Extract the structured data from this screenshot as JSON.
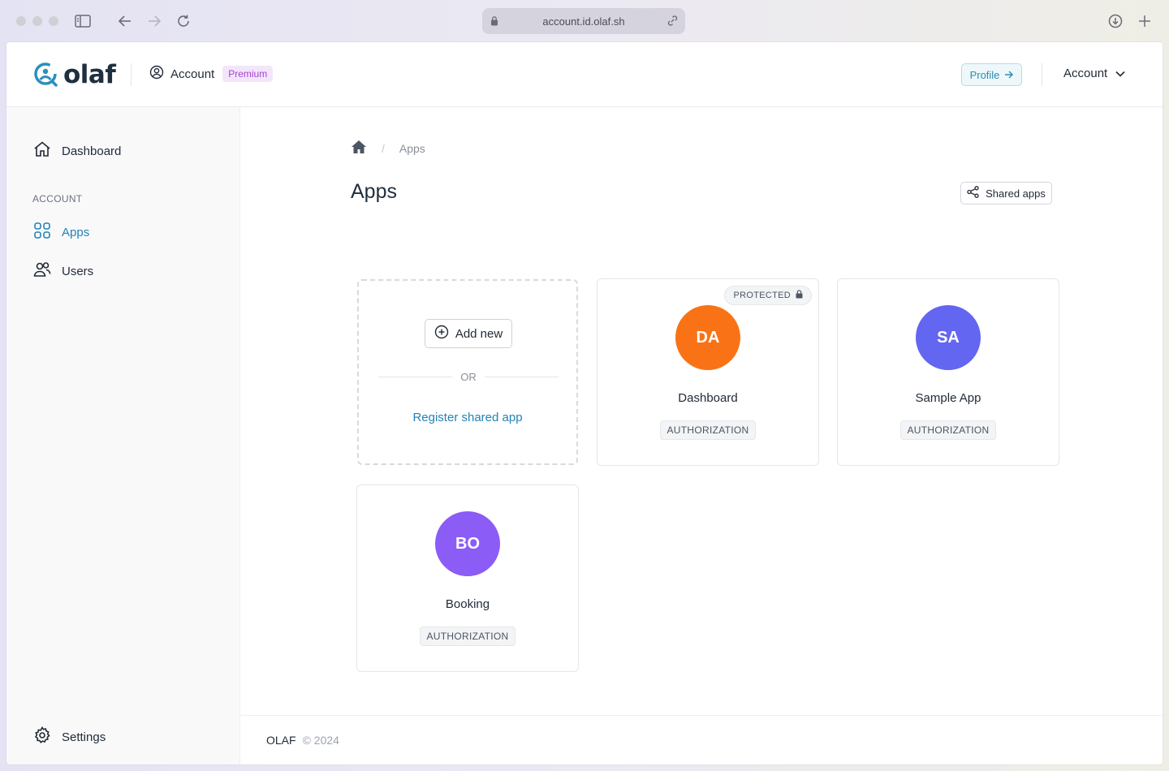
{
  "browser": {
    "url": "account.id.olaf.sh"
  },
  "header": {
    "logo_text": "olaf",
    "account_label": "Account",
    "plan_badge": "Premium",
    "profile_label": "Profile",
    "account_menu_label": "Account"
  },
  "sidebar": {
    "dashboard_label": "Dashboard",
    "section_label": "ACCOUNT",
    "apps_label": "Apps",
    "users_label": "Users",
    "settings_label": "Settings"
  },
  "main": {
    "breadcrumb_current": "Apps",
    "title": "Apps",
    "shared_apps_label": "Shared apps",
    "add_new_label": "Add new",
    "or_label": "OR",
    "register_label": "Register shared app",
    "apps": [
      {
        "initials": "DA",
        "name": "Dashboard",
        "type": "AUTHORIZATION",
        "protected_label": "PROTECTED",
        "color": "#f97316"
      },
      {
        "initials": "SA",
        "name": "Sample App",
        "type": "AUTHORIZATION",
        "color": "#6366f1"
      },
      {
        "initials": "BO",
        "name": "Booking",
        "type": "AUTHORIZATION",
        "color": "#8b5cf6"
      }
    ]
  },
  "footer": {
    "brand": "OLAF",
    "copyright": "© 2024"
  }
}
